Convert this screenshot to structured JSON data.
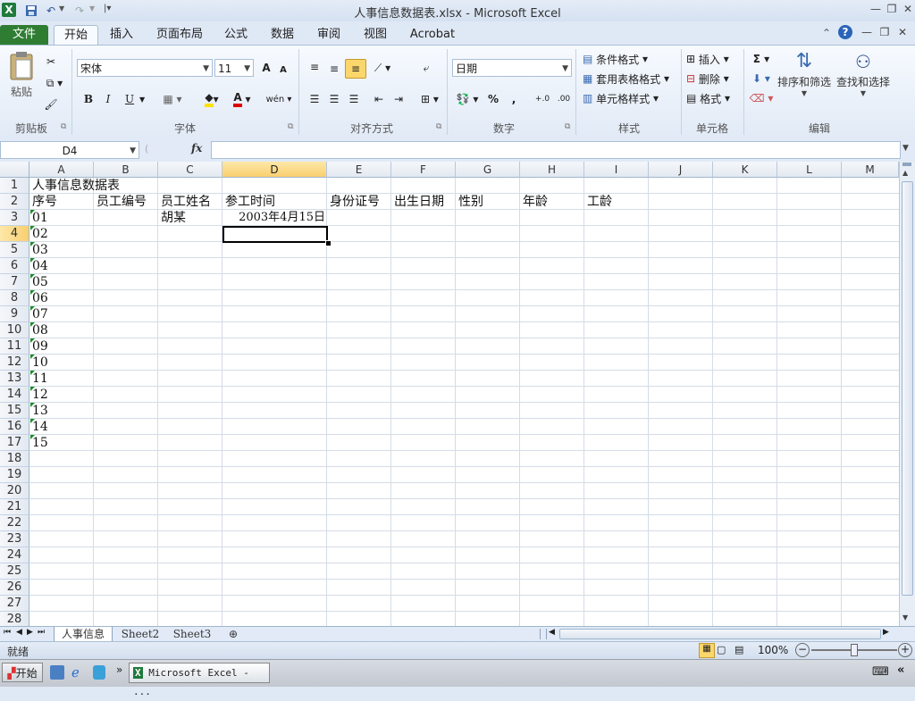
{
  "window": {
    "title": "人事信息数据表.xlsx  -  Microsoft Excel",
    "app_icon": "X"
  },
  "ribbon": {
    "tabs": [
      "文件",
      "开始",
      "插入",
      "页面布局",
      "公式",
      "数据",
      "审阅",
      "视图",
      "Acrobat"
    ],
    "active_tab": "开始",
    "clipboard": {
      "paste": "粘贴",
      "group": "剪贴板"
    },
    "font": {
      "name": "宋体",
      "size": "11",
      "bold": "B",
      "italic": "I",
      "underline": "U",
      "group": "字体",
      "grow": "A",
      "shrink": "A",
      "color_a": "A",
      "phonetic": "wén"
    },
    "alignment": {
      "group": "对齐方式"
    },
    "number": {
      "format": "日期",
      "percent": "%",
      "comma": ",",
      "group": "数字",
      "inc": "+.0",
      "dec": ".00"
    },
    "styles": {
      "conditional": "条件格式",
      "table": "套用表格格式",
      "cell": "单元格样式",
      "group": "样式"
    },
    "cells": {
      "insert": "插入",
      "delete": "删除",
      "format": "格式",
      "group": "单元格"
    },
    "editing": {
      "sigma": "Σ",
      "sort": "排序和筛选",
      "find": "查找和选择",
      "group": "编辑"
    }
  },
  "formula_bar": {
    "name_box": "D4",
    "fx": "fx",
    "content": ""
  },
  "grid": {
    "columns": [
      "A",
      "B",
      "C",
      "D",
      "E",
      "F",
      "G",
      "H",
      "I",
      "J",
      "K",
      "L",
      "M"
    ],
    "selected_column": "D",
    "rows": [
      "1",
      "2",
      "3",
      "4",
      "5",
      "6",
      "7",
      "8",
      "9",
      "10",
      "11",
      "12",
      "13",
      "14",
      "15",
      "16",
      "17",
      "18",
      "19",
      "20",
      "21",
      "22",
      "23",
      "24",
      "25",
      "26",
      "27",
      "28"
    ],
    "selected_row": "4",
    "title_cell": "人事信息数据表",
    "headers": [
      "序号",
      "员工编号",
      "员工姓名",
      "参工时间",
      "身份证号",
      "出生日期",
      "性别",
      "年龄",
      "工龄"
    ],
    "row3": {
      "name": "胡某",
      "date": "2003年4月15日"
    },
    "serials": [
      "01",
      "02",
      "03",
      "04",
      "05",
      "06",
      "07",
      "08",
      "09",
      "10",
      "11",
      "12",
      "13",
      "14",
      "15"
    ]
  },
  "sheets": {
    "tabs": [
      "人事信息",
      "Sheet2",
      "Sheet3"
    ],
    "active": "人事信息"
  },
  "status": {
    "ready": "就绪",
    "zoom": "100%"
  },
  "taskbar": {
    "start": "开始",
    "task": "Microsoft Excel - ..."
  },
  "colors": {
    "file_tab": "#2f7d32",
    "selection_header": "#f9cf6f",
    "triangle": "#1a8a2e"
  }
}
